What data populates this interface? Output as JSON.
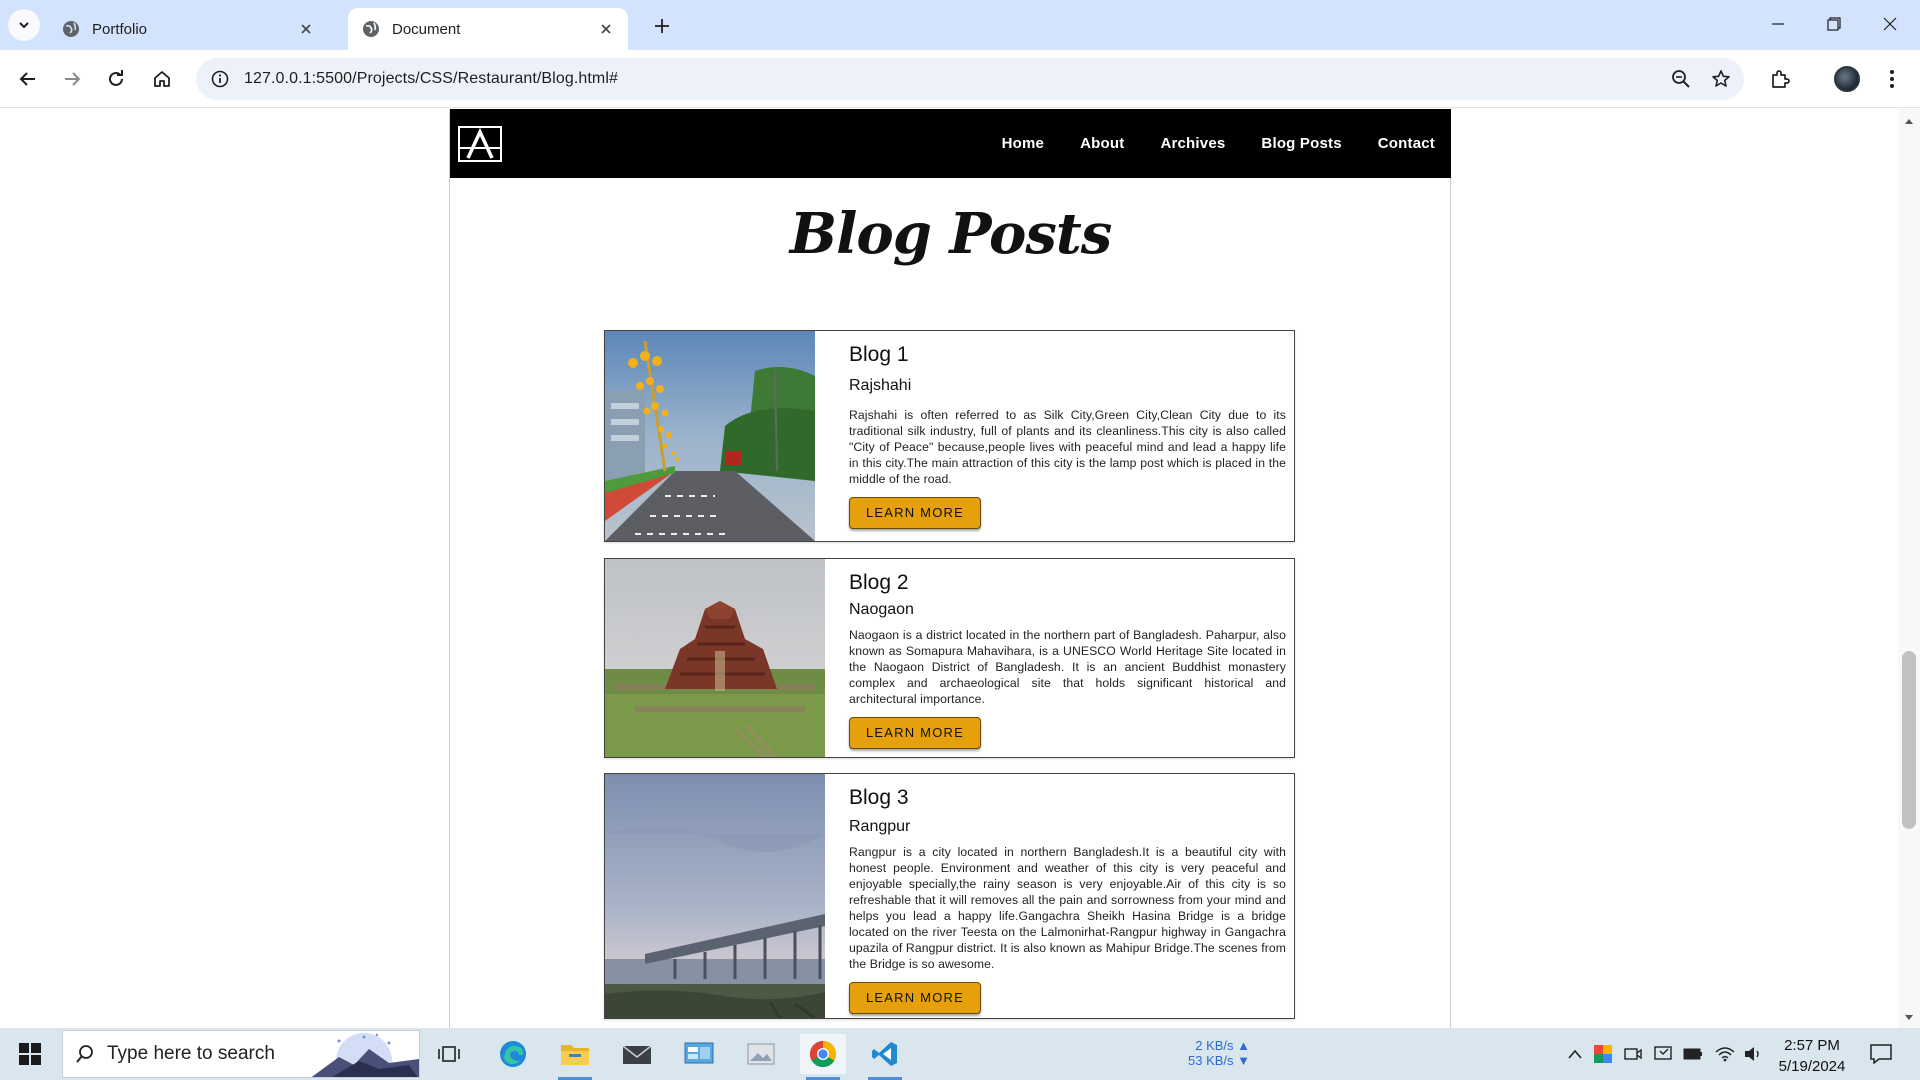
{
  "browser": {
    "tabs": [
      {
        "title": "Portfolio",
        "active": false
      },
      {
        "title": "Document",
        "active": true
      }
    ],
    "url": "127.0.0.1:5500/Projects/CSS/Restaurant/Blog.html#"
  },
  "site": {
    "logo_text": "A",
    "nav": [
      "Home",
      "About",
      "Archives",
      "Blog Posts",
      "Contact"
    ],
    "page_title": "Blog Posts",
    "accent_color": "#e6a00c",
    "posts": [
      {
        "title": "Blog 1",
        "subtitle": "Rajshahi",
        "text": "Rajshahi is often referred to as Silk City,Green City,Clean City due to its traditional silk industry, full of plants and its cleanliness.This city is also called \"City of Peace\" because,people lives with peaceful mind and lead a happy life in this city.The main attraction of this city is the lamp post which is placed in the middle of the road.",
        "button": "LEARN MORE"
      },
      {
        "title": "Blog 2",
        "subtitle": "Naogaon",
        "text": "Naogaon is a district located in the northern part of Bangladesh. Paharpur, also known as Somapura Mahavihara, is a UNESCO World Heritage Site located in the Naogaon District of Bangladesh. It is an ancient Buddhist monastery complex and archaeological site that holds significant historical and architectural importance.",
        "button": "LEARN MORE"
      },
      {
        "title": "Blog 3",
        "subtitle": "Rangpur",
        "text": "Rangpur is a city located in northern Bangladesh.It is a beautiful city with honest people. Environment and weather of this city is very peaceful and enjoyable specially,the rainy season is very enjoyable.Air of this city is so refreshable that it will removes all the pain and sorrowness from your mind and helps you lead a happy life.Gangachra Sheikh Hasina Bridge is a bridge located on the river Teesta on the Lalmonirhat-Rangpur highway in Gangachra upazila of Rangpur district. It is also known as Mahipur Bridge.The scenes from the Bridge is so awesome.",
        "button": "LEARN MORE"
      }
    ]
  },
  "taskbar": {
    "search_placeholder": "Type here to search",
    "net_up": "2 KB/s",
    "net_down": "53 KB/s",
    "time": "2:57 PM",
    "date": "5/19/2024"
  }
}
